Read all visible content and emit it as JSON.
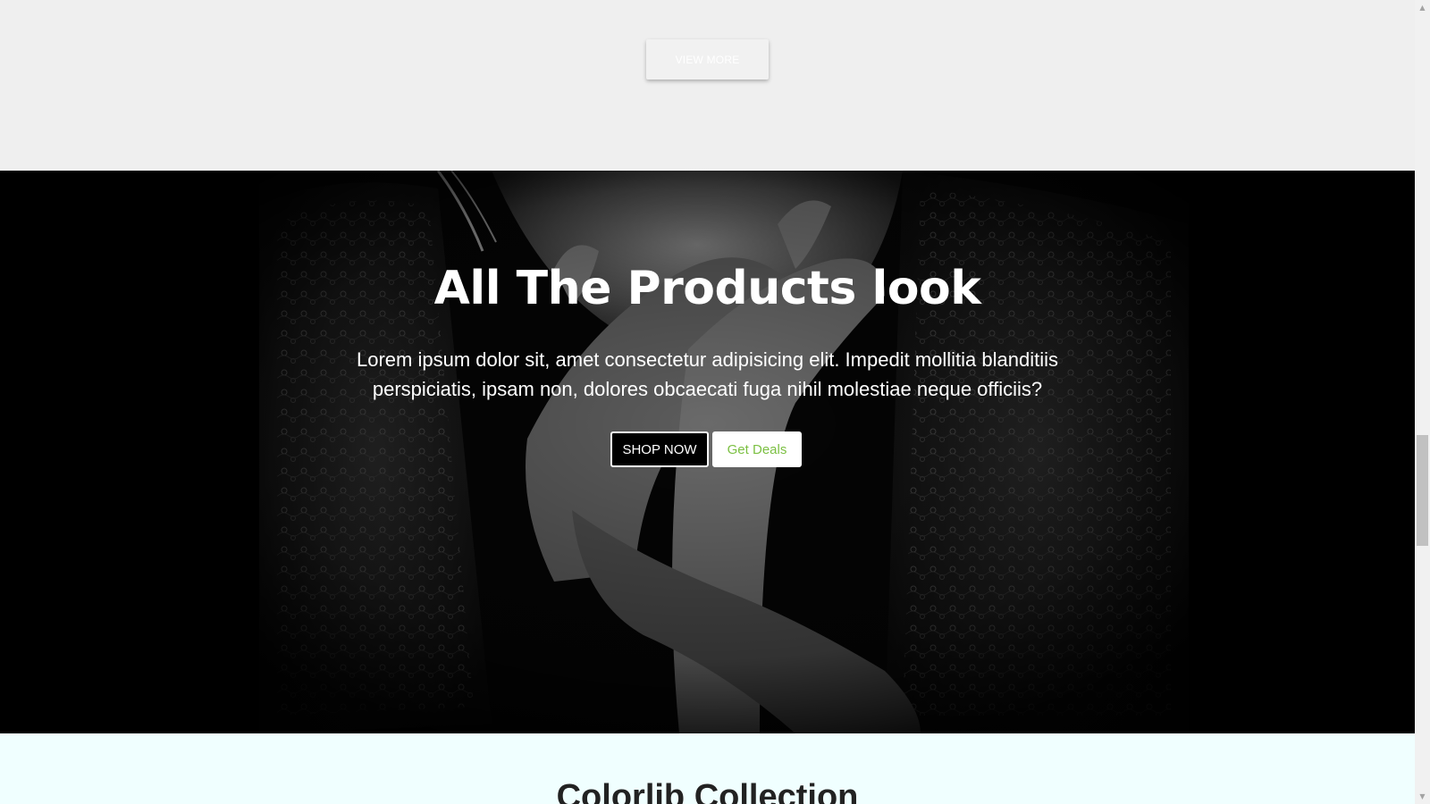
{
  "top_section": {
    "view_more_label": "VIEW MORE"
  },
  "hero": {
    "title": "All The Products look",
    "description": "Lorem ipsum dolor sit, amet consectetur adipisicing elit. Impedit mollitia blanditiis perspiciatis, ipsam non, dolores obcaecati fuga nihil molestiae neque officiis?",
    "shop_now_label": "SHOP NOW",
    "get_deals_label": "Get Deals",
    "background_image": "black-and-white-photo-woman-lace-dress-hands"
  },
  "collection": {
    "title": "Colorlib Collection"
  },
  "colors": {
    "top_bg": "#efefef",
    "hero_bg": "#000000",
    "bottom_bg": "#f0ffff",
    "accent_green": "#7cc043"
  },
  "scrollbar": {
    "up_icon": "triangle-up",
    "down_icon": "triangle-down"
  }
}
